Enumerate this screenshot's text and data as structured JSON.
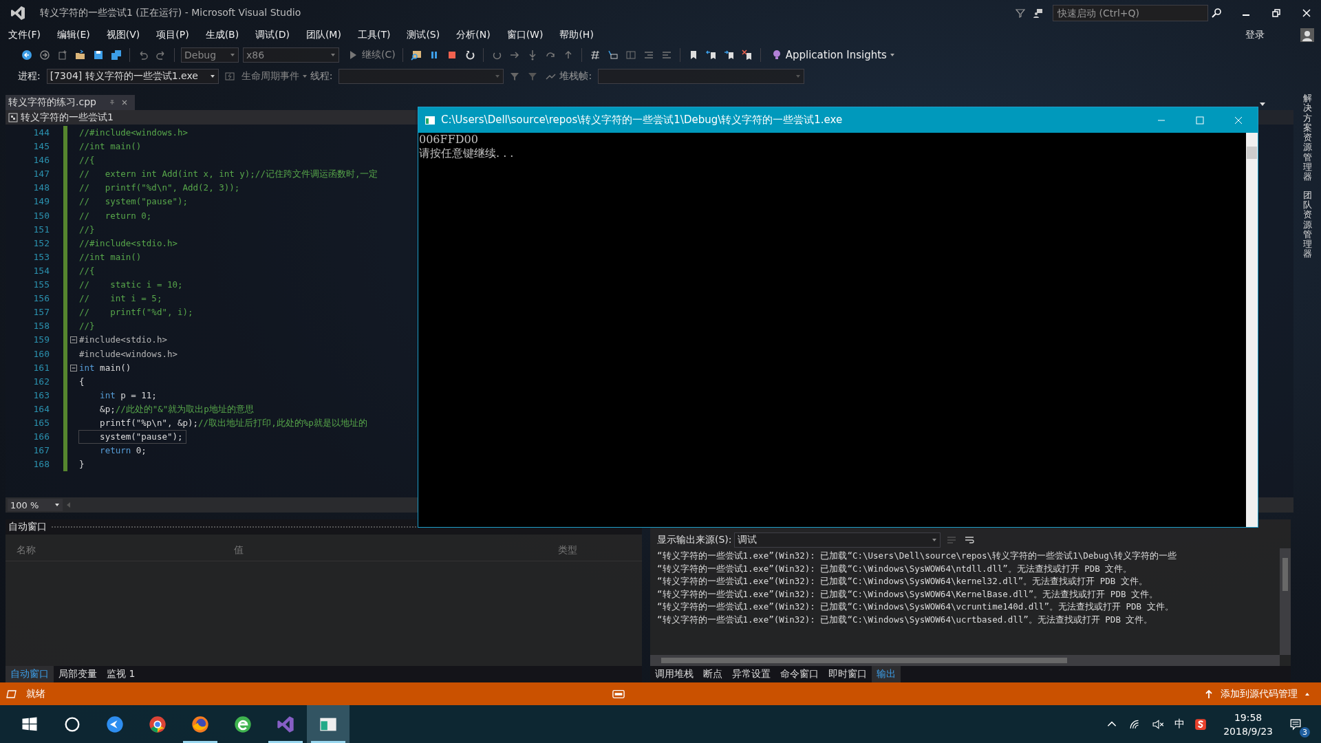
{
  "window": {
    "title": "转义字符的一些尝试1 (正在运行) - Microsoft Visual Studio"
  },
  "quick_launch": {
    "placeholder": "快速启动 (Ctrl+Q)"
  },
  "sign_in": "登录",
  "menu": [
    "文件(F)",
    "编辑(E)",
    "视图(V)",
    "项目(P)",
    "生成(B)",
    "调试(D)",
    "团队(M)",
    "工具(T)",
    "测试(S)",
    "分析(N)",
    "窗口(W)",
    "帮助(H)"
  ],
  "toolbar": {
    "configuration": "Debug",
    "platform": "x86",
    "continue": "继续(C)",
    "application_insights": "Application Insights"
  },
  "debug_toolbar": {
    "process_label": "进程:",
    "process": "[7304] 转义字符的一些尝试1.exe",
    "lifecycle": "生命周期事件",
    "thread_label": "线程:",
    "stack_label": "堆栈帧:"
  },
  "document_tab": {
    "title": "转义字符的练习.cpp"
  },
  "editor": {
    "project": "转义字符的一些尝试1",
    "zoom": "100 %",
    "lines": [
      {
        "number": "144",
        "fold": false,
        "current": false,
        "tokens": [
          {
            "kind": "comment",
            "text": "//#include<windows.h>"
          }
        ]
      },
      {
        "number": "145",
        "fold": false,
        "current": false,
        "tokens": [
          {
            "kind": "comment",
            "text": "//int main()"
          }
        ]
      },
      {
        "number": "146",
        "fold": false,
        "current": false,
        "tokens": [
          {
            "kind": "comment",
            "text": "//{"
          }
        ]
      },
      {
        "number": "147",
        "fold": false,
        "current": false,
        "tokens": [
          {
            "kind": "comment",
            "text": "//   extern int Add(int x, int y);//记住跨文件调运函数时,一定"
          }
        ]
      },
      {
        "number": "148",
        "fold": false,
        "current": false,
        "tokens": [
          {
            "kind": "comment",
            "text": "//   printf(\"%d\\n\", Add(2, 3));"
          }
        ]
      },
      {
        "number": "149",
        "fold": false,
        "current": false,
        "tokens": [
          {
            "kind": "comment",
            "text": "//   system(\"pause\");"
          }
        ]
      },
      {
        "number": "150",
        "fold": false,
        "current": false,
        "tokens": [
          {
            "kind": "comment",
            "text": "//   return 0;"
          }
        ]
      },
      {
        "number": "151",
        "fold": false,
        "current": false,
        "tokens": [
          {
            "kind": "comment",
            "text": "//}"
          }
        ]
      },
      {
        "number": "152",
        "fold": false,
        "current": false,
        "tokens": [
          {
            "kind": "comment",
            "text": "//#include<stdio.h>"
          }
        ]
      },
      {
        "number": "153",
        "fold": false,
        "current": false,
        "tokens": [
          {
            "kind": "comment",
            "text": "//int main()"
          }
        ]
      },
      {
        "number": "154",
        "fold": false,
        "current": false,
        "tokens": [
          {
            "kind": "comment",
            "text": "//{"
          }
        ]
      },
      {
        "number": "155",
        "fold": false,
        "current": false,
        "tokens": [
          {
            "kind": "comment",
            "text": "//    static i = 10;"
          }
        ]
      },
      {
        "number": "156",
        "fold": false,
        "current": false,
        "tokens": [
          {
            "kind": "comment",
            "text": "//    int i = 5;"
          }
        ]
      },
      {
        "number": "157",
        "fold": false,
        "current": false,
        "tokens": [
          {
            "kind": "comment",
            "text": "//    printf(\"%d\", i);"
          }
        ]
      },
      {
        "number": "158",
        "fold": false,
        "current": false,
        "tokens": [
          {
            "kind": "comment",
            "text": "//}"
          }
        ]
      },
      {
        "number": "159",
        "fold": true,
        "current": false,
        "tokens": [
          {
            "kind": "preprocessor",
            "text": "#include<stdio.h>"
          }
        ]
      },
      {
        "number": "160",
        "fold": false,
        "current": false,
        "tokens": [
          {
            "kind": "preprocessor",
            "text": "#include<windows.h>"
          }
        ]
      },
      {
        "number": "161",
        "fold": true,
        "current": false,
        "tokens": [
          {
            "kind": "keyword",
            "text": "int"
          },
          {
            "kind": "plain",
            "text": " main()"
          }
        ]
      },
      {
        "number": "162",
        "fold": false,
        "current": false,
        "tokens": [
          {
            "kind": "plain",
            "text": "{"
          }
        ]
      },
      {
        "number": "163",
        "fold": false,
        "current": false,
        "tokens": [
          {
            "kind": "keyword",
            "text": "    int"
          },
          {
            "kind": "plain",
            "text": " p = 11;"
          }
        ]
      },
      {
        "number": "164",
        "fold": false,
        "current": false,
        "tokens": [
          {
            "kind": "plain",
            "text": "    &p;"
          },
          {
            "kind": "comment",
            "text": "//此处的\"&\"就为取出p地址的意思"
          }
        ]
      },
      {
        "number": "165",
        "fold": false,
        "current": false,
        "tokens": [
          {
            "kind": "plain",
            "text": "    printf(\"%p\\n\", &p);"
          },
          {
            "kind": "comment",
            "text": "//取出地址后打印,此处的%p就是以地址的"
          }
        ]
      },
      {
        "number": "166",
        "fold": false,
        "current": true,
        "tokens": [
          {
            "kind": "plain",
            "text": "    system(\"pause\");"
          }
        ]
      },
      {
        "number": "167",
        "fold": false,
        "current": false,
        "tokens": [
          {
            "kind": "keyword",
            "text": "    return"
          },
          {
            "kind": "plain",
            "text": " 0;"
          }
        ]
      },
      {
        "number": "168",
        "fold": false,
        "current": false,
        "tokens": [
          {
            "kind": "plain",
            "text": "}"
          }
        ]
      }
    ]
  },
  "console": {
    "title": "C:\\Users\\Dell\\source\\repos\\转义字符的一些尝试1\\Debug\\转义字符的一些尝试1.exe",
    "lines": [
      "006FFD00",
      "请按任意键继续. . ."
    ]
  },
  "autos": {
    "title": "自动窗口",
    "columns": [
      "名称",
      "值",
      "类型"
    ],
    "tabs": [
      {
        "label": "自动窗口",
        "selected": true
      },
      {
        "label": "局部变量",
        "selected": false
      },
      {
        "label": "监视 1",
        "selected": false
      }
    ]
  },
  "output": {
    "source_label": "显示输出来源(S):",
    "source": "调试",
    "lines": [
      "“转义字符的一些尝试1.exe”(Win32): 已加载“C:\\Users\\Dell\\source\\repos\\转义字符的一些尝试1\\Debug\\转义字符的一些",
      "“转义字符的一些尝试1.exe”(Win32): 已加载“C:\\Windows\\SysWOW64\\ntdll.dll”。无法查找或打开 PDB 文件。",
      "“转义字符的一些尝试1.exe”(Win32): 已加载“C:\\Windows\\SysWOW64\\kernel32.dll”。无法查找或打开 PDB 文件。",
      "“转义字符的一些尝试1.exe”(Win32): 已加载“C:\\Windows\\SysWOW64\\KernelBase.dll”。无法查找或打开 PDB 文件。",
      "“转义字符的一些尝试1.exe”(Win32): 已加载“C:\\Windows\\SysWOW64\\vcruntime140d.dll”。无法查找或打开 PDB 文件。",
      "“转义字符的一些尝试1.exe”(Win32): 已加载“C:\\Windows\\SysWOW64\\ucrtbased.dll”。无法查找或打开 PDB 文件。"
    ],
    "tabs": [
      {
        "label": "调用堆栈",
        "selected": false
      },
      {
        "label": "断点",
        "selected": false
      },
      {
        "label": "异常设置",
        "selected": false
      },
      {
        "label": "命令窗口",
        "selected": false
      },
      {
        "label": "即时窗口",
        "selected": false
      },
      {
        "label": "输出",
        "selected": true
      }
    ]
  },
  "side_tabs": [
    "解决方案资源管理器",
    "团队资源管理器"
  ],
  "status_bar": {
    "text": "就绪",
    "source_control": "添加到源代码管理"
  },
  "taskbar": {
    "time": "19:58",
    "date": "2018/9/23",
    "ime": "中",
    "notifications": "3"
  }
}
